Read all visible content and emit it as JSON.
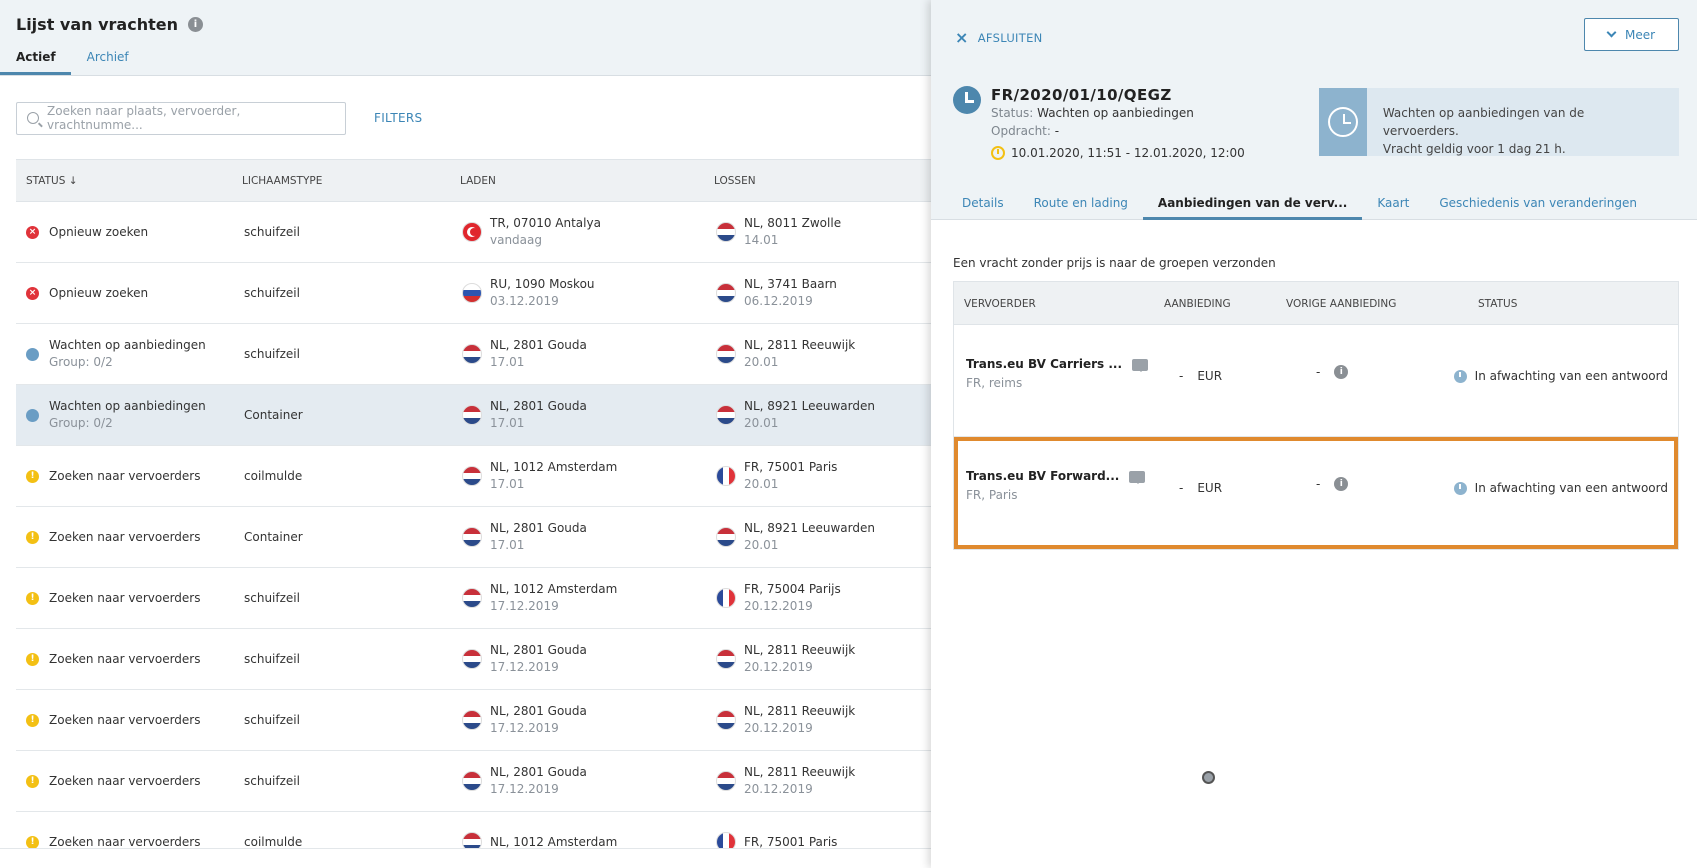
{
  "list": {
    "title": "Lijst van vrachten",
    "tabs": [
      "Actief",
      "Archief"
    ],
    "search_placeholder": "Zoeken naar plaats, vervoerder, vrachtnumme...",
    "filters_label": "FILTERS",
    "columns": [
      "STATUS ↓",
      "LICHAAMSTYPE",
      "LADEN",
      "LOSSEN"
    ],
    "rows": [
      {
        "status": "Opnieuw zoeken",
        "status_sub": "",
        "icon": "red",
        "body": "schuifzeil",
        "load_flag": "tr",
        "load": "TR, 07010 Antalya",
        "load_date": "vandaag",
        "unload_flag": "nl",
        "unload": "NL, 8011 Zwolle",
        "unload_date": "14.01"
      },
      {
        "status": "Opnieuw zoeken",
        "status_sub": "",
        "icon": "red",
        "body": "schuifzeil",
        "load_flag": "ru",
        "load": "RU, 1090 Moskou",
        "load_date": "03.12.2019",
        "unload_flag": "nl",
        "unload": "NL, 3741 Baarn",
        "unload_date": "06.12.2019"
      },
      {
        "status": "Wachten op aanbiedingen",
        "status_sub": "Group: 0/2",
        "icon": "clock",
        "body": "schuifzeil",
        "load_flag": "nl",
        "load": "NL, 2801 Gouda",
        "load_date": "17.01",
        "unload_flag": "nl",
        "unload": "NL, 2811 Reeuwijk",
        "unload_date": "20.01"
      },
      {
        "status": "Wachten op aanbiedingen",
        "status_sub": "Group: 0/2",
        "icon": "clock",
        "body": "Container",
        "load_flag": "nl",
        "load": "NL, 2801 Gouda",
        "load_date": "17.01",
        "unload_flag": "nl",
        "unload": "NL, 8921 Leeuwarden",
        "unload_date": "20.01",
        "selected": true
      },
      {
        "status": "Zoeken naar vervoerders",
        "status_sub": "",
        "icon": "yellow",
        "body": "coilmulde",
        "load_flag": "nl",
        "load": "NL, 1012 Amsterdam",
        "load_date": "17.01",
        "unload_flag": "fr",
        "unload": "FR, 75001 Paris",
        "unload_date": "20.01"
      },
      {
        "status": "Zoeken naar vervoerders",
        "status_sub": "",
        "icon": "yellow",
        "body": "Container",
        "load_flag": "nl",
        "load": "NL, 2801 Gouda",
        "load_date": "17.01",
        "unload_flag": "nl",
        "unload": "NL, 8921 Leeuwarden",
        "unload_date": "20.01"
      },
      {
        "status": "Zoeken naar vervoerders",
        "status_sub": "",
        "icon": "yellow",
        "body": "schuifzeil",
        "load_flag": "nl",
        "load": "NL, 1012 Amsterdam",
        "load_date": "17.12.2019",
        "unload_flag": "fr",
        "unload": "FR, 75004 Parijs",
        "unload_date": "20.12.2019"
      },
      {
        "status": "Zoeken naar vervoerders",
        "status_sub": "",
        "icon": "yellow",
        "body": "schuifzeil",
        "load_flag": "nl",
        "load": "NL, 2801 Gouda",
        "load_date": "17.12.2019",
        "unload_flag": "nl",
        "unload": "NL, 2811 Reeuwijk",
        "unload_date": "20.12.2019"
      },
      {
        "status": "Zoeken naar vervoerders",
        "status_sub": "",
        "icon": "yellow",
        "body": "schuifzeil",
        "load_flag": "nl",
        "load": "NL, 2801 Gouda",
        "load_date": "17.12.2019",
        "unload_flag": "nl",
        "unload": "NL, 2811 Reeuwijk",
        "unload_date": "20.12.2019"
      },
      {
        "status": "Zoeken naar vervoerders",
        "status_sub": "",
        "icon": "yellow",
        "body": "schuifzeil",
        "load_flag": "nl",
        "load": "NL, 2801 Gouda",
        "load_date": "17.12.2019",
        "unload_flag": "nl",
        "unload": "NL, 2811 Reeuwijk",
        "unload_date": "20.12.2019"
      },
      {
        "status": "Zoeken naar vervoerders",
        "status_sub": "",
        "icon": "yellow",
        "body": "coilmulde",
        "load_flag": "nl",
        "load": "NL, 1012 Amsterdam",
        "load_date": "",
        "unload_flag": "fr",
        "unload": "FR, 75001 Paris",
        "unload_date": ""
      }
    ]
  },
  "panel": {
    "close_label": "AFSLUITEN",
    "more_label": "Meer",
    "cargo_id": "FR/2020/01/10/QEGZ",
    "status_label": "Status:",
    "status_value": "Wachten op aanbiedingen",
    "order_label": "Opdracht:",
    "order_value": "-",
    "validity": "10.01.2020, 11:51 - 12.01.2020, 12:00",
    "notice_line1": "Wachten op aanbiedingen van de vervoerders.",
    "notice_line2": "Vracht geldig voor 1 dag 21 h.",
    "tabs": [
      "Details",
      "Route en lading",
      "Aanbiedingen van de verv...",
      "Kaart",
      "Geschiedenis van veranderingen"
    ],
    "active_tab": 2,
    "group_message": "Een vracht zonder prijs is naar de groepen verzonden",
    "offer_columns": [
      "VERVOERDER",
      "AANBIEDING",
      "VORIGE AANBIEDING",
      "STATUS"
    ],
    "offers": [
      {
        "carrier": "Trans.eu BV Carriers ...",
        "location": "FR, reims",
        "offer_value": "-",
        "currency": "EUR",
        "previous": "-",
        "status": "In afwachting van een antwoord"
      },
      {
        "carrier": "Trans.eu BV Forward...",
        "location": "FR, Paris",
        "offer_value": "-",
        "currency": "EUR",
        "previous": "-",
        "status": "In afwachting van een antwoord",
        "highlighted": true
      }
    ]
  },
  "colors": {
    "accent": "#3c86b6",
    "highlight": "#e08a2e",
    "error": "#e0333a",
    "warning": "#f3c014"
  }
}
